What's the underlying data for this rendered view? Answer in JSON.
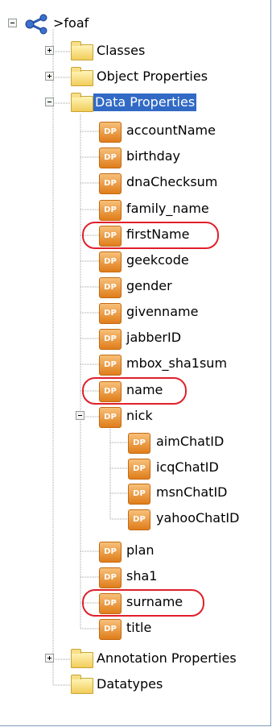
{
  "tree": {
    "root": {
      "label": ">foaf",
      "icon": "ontology-icon",
      "expanded": true
    },
    "classes": {
      "label": "Classes",
      "icon": "folder-icon",
      "expanded": false
    },
    "object_properties": {
      "label": "Object Properties",
      "icon": "folder-icon",
      "expanded": false
    },
    "data_properties": {
      "label": "Data Properties",
      "icon": "folder-icon",
      "expanded": true,
      "selected": true,
      "items": [
        {
          "label": "accountName",
          "badge": "DP"
        },
        {
          "label": "birthday",
          "badge": "DP"
        },
        {
          "label": "dnaChecksum",
          "badge": "DP"
        },
        {
          "label": "family_name",
          "badge": "DP"
        },
        {
          "label": "firstName",
          "badge": "DP",
          "highlighted": true
        },
        {
          "label": "geekcode",
          "badge": "DP"
        },
        {
          "label": "gender",
          "badge": "DP"
        },
        {
          "label": "givenname",
          "badge": "DP"
        },
        {
          "label": "jabberID",
          "badge": "DP"
        },
        {
          "label": "mbox_sha1sum",
          "badge": "DP"
        },
        {
          "label": "name",
          "badge": "DP",
          "highlighted": true
        },
        {
          "label": "nick",
          "badge": "DP",
          "expanded": true,
          "children": [
            {
              "label": "aimChatID",
              "badge": "DP"
            },
            {
              "label": "icqChatID",
              "badge": "DP"
            },
            {
              "label": "msnChatID",
              "badge": "DP"
            },
            {
              "label": "yahooChatID",
              "badge": "DP"
            }
          ]
        },
        {
          "label": "plan",
          "badge": "DP"
        },
        {
          "label": "sha1",
          "badge": "DP"
        },
        {
          "label": "surname",
          "badge": "DP",
          "highlighted": true
        },
        {
          "label": "title",
          "badge": "DP"
        }
      ]
    },
    "annotation_properties": {
      "label": "Annotation Properties",
      "icon": "folder-icon",
      "expanded": false
    },
    "datatypes": {
      "label": "Datatypes",
      "icon": "folder-icon"
    }
  },
  "colors": {
    "selection": "#316ac5",
    "highlight_outline": "#e0202a",
    "dp_badge": "#e8892a",
    "folder": "#f6d56d",
    "tree_lines": "#a0a0a0"
  }
}
